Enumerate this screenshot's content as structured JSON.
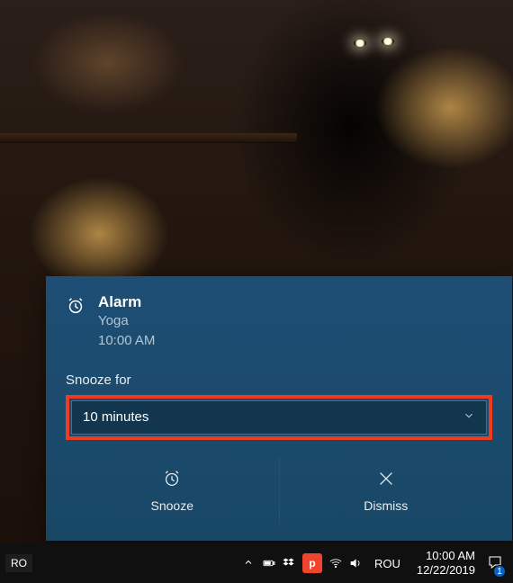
{
  "notification": {
    "title": "Alarm",
    "name": "Yoga",
    "time": "10:00 AM",
    "snooze_label": "Snooze for",
    "snooze_value": "10 minutes",
    "actions": {
      "snooze": "Snooze",
      "dismiss": "Dismiss"
    }
  },
  "taskbar": {
    "lang_primary": "RO",
    "lang_input": "ROU",
    "clock_time": "10:00 AM",
    "clock_date": "12/22/2019",
    "action_center_badge": "1",
    "pinned_app_letter": "p"
  }
}
